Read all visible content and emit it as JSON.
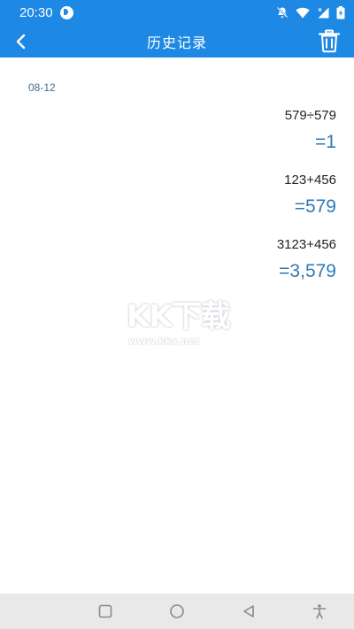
{
  "status_bar": {
    "time": "20:30",
    "icons": [
      "app-notification-icon",
      "mute-icon",
      "wifi-icon",
      "signal-icon",
      "battery-charging-icon"
    ]
  },
  "app_bar": {
    "title": "历史记录",
    "back_icon": "chevron-left-icon",
    "delete_icon": "trash-icon",
    "background": "#1e88e5"
  },
  "history": {
    "date": "08-12",
    "records": [
      {
        "expression": "579÷579",
        "result": "=1"
      },
      {
        "expression": "123+456",
        "result": "=579"
      },
      {
        "expression": "3123+456",
        "result": "=3,579"
      }
    ],
    "result_color": "#2f79b6"
  },
  "watermark": {
    "logo": "KK下载",
    "url": "www.kkx.net"
  },
  "nav_bar": {
    "icons": [
      "recents-square-icon",
      "home-circle-icon",
      "back-triangle-icon",
      "accessibility-icon"
    ]
  }
}
